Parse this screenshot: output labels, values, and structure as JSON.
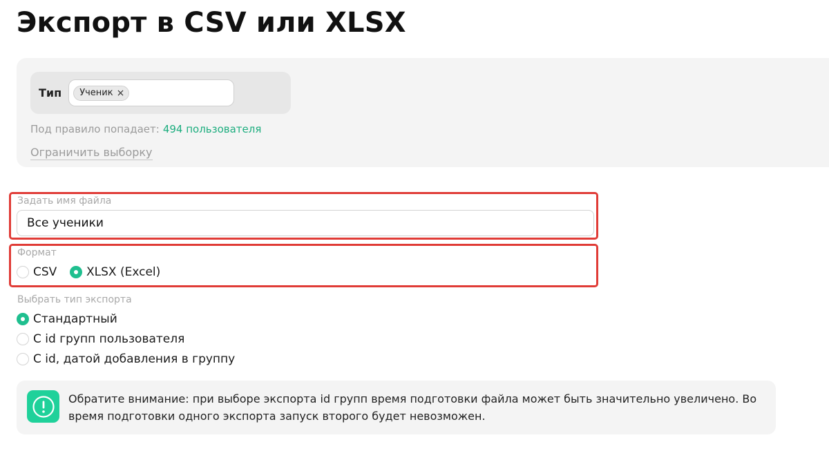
{
  "page": {
    "title": "Экспорт в CSV или XLSX"
  },
  "filter": {
    "rule_label": "Тип",
    "tag_label": "Ученик",
    "tag_remove": "×",
    "count_prefix": "Под правило попадает:",
    "count_value": "494 пользователя",
    "limit_link": "Ограничить выборку"
  },
  "filename": {
    "label": "Задать имя файла",
    "value": "Все ученики"
  },
  "format": {
    "label": "Формат",
    "options": [
      {
        "label": "CSV",
        "selected": false
      },
      {
        "label": "XLSX (Excel)",
        "selected": true
      }
    ]
  },
  "export_type": {
    "label": "Выбрать тип экспорта",
    "options": [
      {
        "label": "Стандартный",
        "selected": true
      },
      {
        "label": "С id групп пользователя",
        "selected": false
      },
      {
        "label": "С id, датой добавления в группу",
        "selected": false
      }
    ]
  },
  "notice": {
    "icon": "exclamation-circle-icon",
    "text": "Обратите внимание: при выборе экспорта id групп время подготовки файла может быть значительно увеличено. Во время подготовки одного экспорта запуск второго будет невозможен."
  },
  "colors": {
    "accent": "#1fbf8f",
    "highlight": "#e03b36",
    "count_green": "#1cad7e"
  }
}
